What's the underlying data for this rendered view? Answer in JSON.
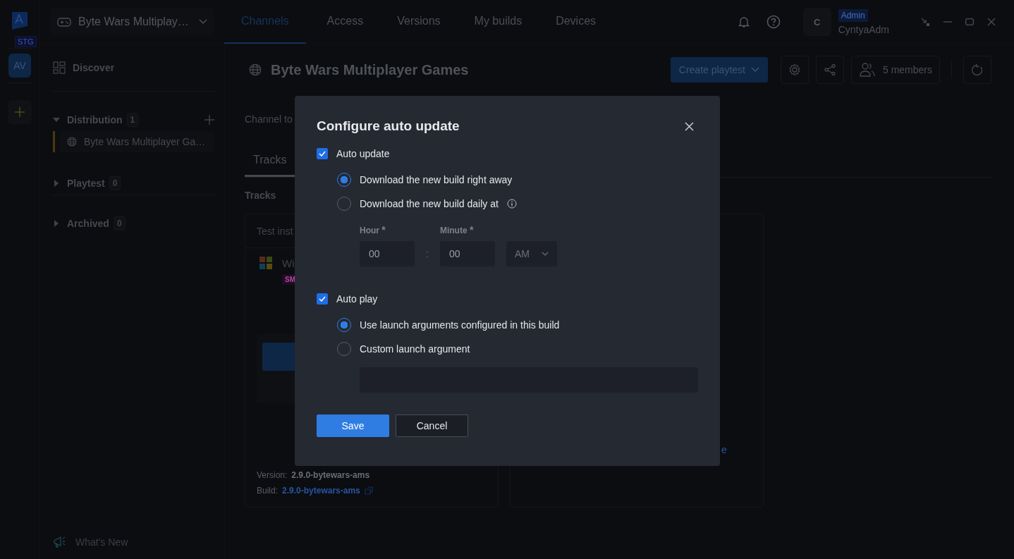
{
  "app": {
    "env_badge": "STG",
    "workspace_avatar": "AV"
  },
  "project_selector": {
    "label": "Byte Wars Multiplay…"
  },
  "nav_tabs": [
    {
      "label": "Channels",
      "selected": true
    },
    {
      "label": "Access",
      "selected": false
    },
    {
      "label": "Versions",
      "selected": false
    },
    {
      "label": "My builds",
      "selected": false
    },
    {
      "label": "Devices",
      "selected": false
    }
  ],
  "user": {
    "avatar": "C",
    "role": "Admin",
    "name": "CyntyaAdm"
  },
  "sidebar": {
    "discover": "Discover",
    "groups": [
      {
        "label": "Distribution",
        "count": "1",
        "expanded": true,
        "children": [
          {
            "label": "Byte Wars Multiplayer Ga…",
            "selected": true
          }
        ]
      },
      {
        "label": "Playtest",
        "count": "0",
        "expanded": false
      },
      {
        "label": "Archived",
        "count": "0",
        "expanded": false
      }
    ],
    "whats_new": "What's New"
  },
  "page": {
    "title": "Byte Wars Multiplayer Games",
    "create_button": "Create playtest",
    "members_button": "5 members",
    "channel_label": "Channel to",
    "tabs": [
      {
        "label": "Tracks",
        "selected": true
      }
    ],
    "section_title": "Tracks",
    "track_card": {
      "header": "Test inst",
      "platform": "Wi",
      "badge": "SM",
      "version_label": "Version:",
      "version": "2.9.0-bytewars-ams",
      "build_label": "Build:",
      "build": "2.9.0-bytewars-ams"
    },
    "link_fragment": "e"
  },
  "dialog": {
    "title": "Configure auto update",
    "sections": [
      {
        "kind": "schedule",
        "label": "Auto update",
        "checked": true,
        "options": [
          {
            "kind": "plain",
            "label": "Download the new build right away",
            "selected": true
          },
          {
            "kind": "with_info",
            "label": "Download the new build daily at",
            "selected": false
          }
        ],
        "hour": {
          "label": "Hour",
          "required_mark": "*",
          "value": "00"
        },
        "separator": ":",
        "minute": {
          "label": "Minute",
          "required_mark": "*",
          "value": "00"
        },
        "period": "AM"
      },
      {
        "kind": "argument",
        "label": "Auto play",
        "checked": true,
        "options": [
          {
            "kind": "plain",
            "label": "Use launch arguments configured in this build",
            "selected": true
          },
          {
            "kind": "plain",
            "label": "Custom launch argument",
            "selected": false
          }
        ]
      }
    ],
    "save": "Save",
    "cancel": "Cancel"
  }
}
